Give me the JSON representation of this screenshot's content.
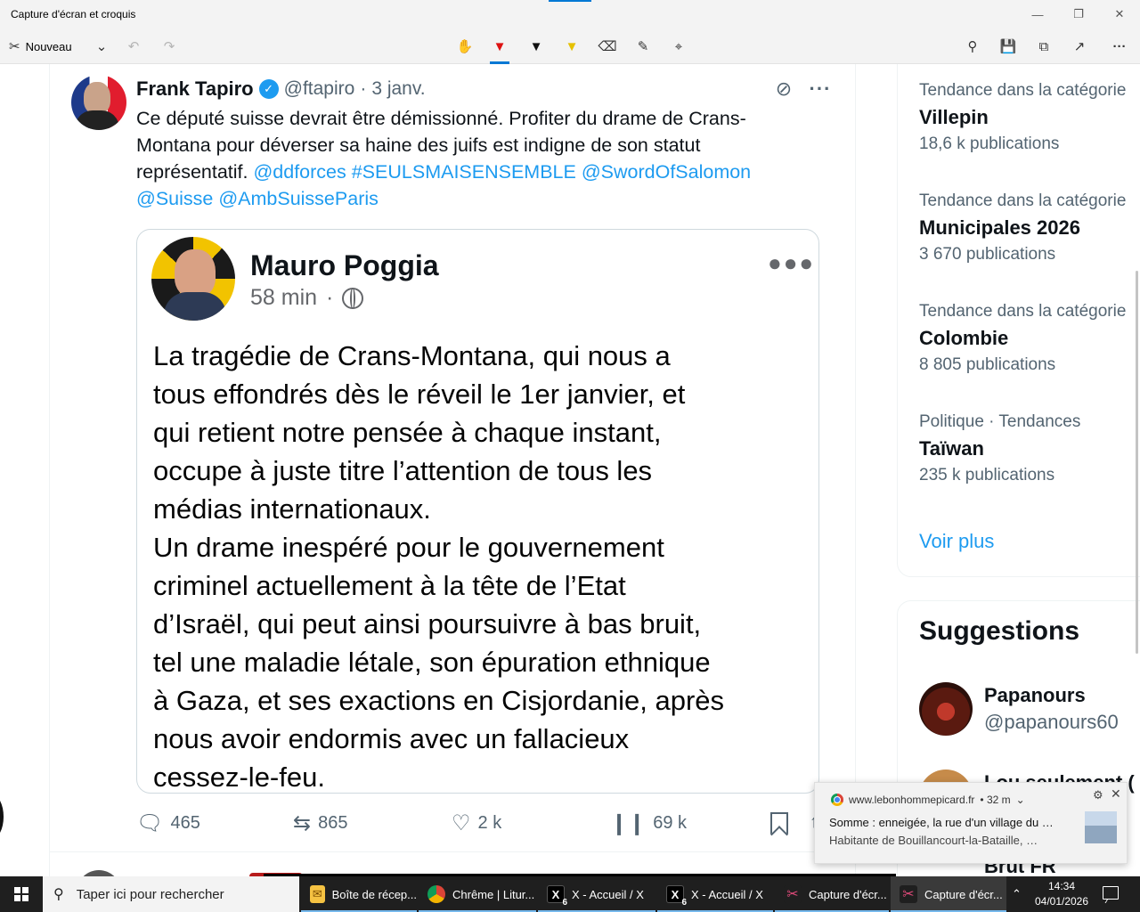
{
  "app": {
    "title": "Capture d'écran et croquis",
    "new_label": "Nouveau",
    "colors": {
      "accent": "#0078d4",
      "chrome_bg": "#f3f3f3"
    }
  },
  "tweet": {
    "author": "Frank Tapiro",
    "handle": "@ftapiro",
    "dot": "·",
    "date": "3 janv.",
    "text_lines": [
      "Ce député suisse devrait être démissionné. Profiter du drame de Crans-",
      "Montana pour déverser sa haine des juifs est indigne de son statut"
    ],
    "text_prefix": "représentatif. ",
    "links_line3": "@ddforces #SEULSMAISENSEMBLE @SwordOfSalomon",
    "links_line4": "@Suisse @AmbSuisseParis",
    "embed": {
      "author": "Mauro Poggia",
      "time": "58 min",
      "dot": "·",
      "lines": [
        "La tragédie de Crans-Montana, qui nous a",
        "tous effondrés dès le réveil le 1er janvier, et",
        "qui retient notre pensée à chaque instant,",
        "occupe à juste titre l’attention de tous les",
        "médias internationaux.",
        "Un drame inespéré pour le gouvernement",
        "criminel actuellement à la tête de l’Etat",
        "d’Israël, qui peut ainsi poursuivre à bas bruit,",
        "tel une maladie létale, son épuration ethnique",
        "à Gaza, et ses exactions en Cisjordanie, après",
        "nous avoir endormis avec un fallacieux",
        "cessez-le-feu."
      ]
    },
    "stats": {
      "replies": "465",
      "reposts": "865",
      "likes": "2 k",
      "views": "69 k"
    },
    "colors": {
      "link": "#1d9bf0",
      "verified": "#1d9bf0"
    }
  },
  "sidebar": {
    "trends": [
      {
        "category": "Tendance dans la catégorie",
        "name": "Villepin",
        "count": "18,6 k publications"
      },
      {
        "category": "Tendance dans la catégorie",
        "name": "Municipales 2026",
        "count": "3 670 publications"
      },
      {
        "category": "Tendance dans la catégorie",
        "name": "Colombie",
        "count": "8 805 publications"
      },
      {
        "category": "Politique · Tendances",
        "name": "Taïwan",
        "count": "235 k publications"
      }
    ],
    "see_more": "Voir plus",
    "suggestions_title": "Suggestions",
    "suggestions": [
      {
        "name": "Papanours",
        "handle": "@papanours60"
      },
      {
        "name": "Lou seulement ("
      },
      {
        "name": "Brut FR"
      }
    ]
  },
  "toast": {
    "source": "www.lebonhommepicard.fr",
    "age": "• 32 m",
    "title": "Somme : enneigée, la rue d'un village du …",
    "body": "Habitante de Bouillancourt-la-Bataille, …"
  },
  "taskbar": {
    "search_placeholder": "Taper ici pour rechercher",
    "tasks": [
      {
        "label": "Boîte de récep...",
        "icon": "mail-icon"
      },
      {
        "label": "Chrême | Litur...",
        "icon": "chrome-icon"
      },
      {
        "label": "X - Accueil / X",
        "icon": "x-icon",
        "badge": "6"
      },
      {
        "label": "X - Accueil / X",
        "icon": "x-icon",
        "badge": "6"
      },
      {
        "label": "Capture d'écr...",
        "icon": "snip-icon"
      },
      {
        "label": "Capture d'écr...",
        "icon": "snip-icon"
      }
    ],
    "time": "14:34",
    "date": "04/01/2026"
  }
}
